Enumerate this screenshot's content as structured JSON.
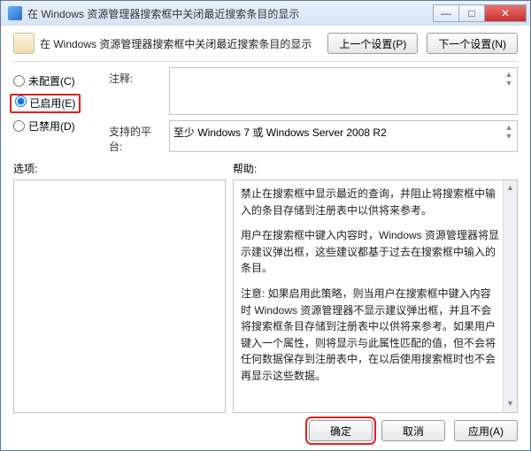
{
  "title": "在 Windows 资源管理器搜索框中关闭最近搜索条目的显示",
  "header_title": "在 Windows 资源管理器搜索框中关闭最近搜索条目的显示",
  "buttons": {
    "prev": "上一个设置(P)",
    "next": "下一个设置(N)",
    "ok": "确定",
    "cancel": "取消",
    "apply": "应用(A)"
  },
  "radios": {
    "not_configured": "未配置(C)",
    "enabled": "已启用(E)",
    "disabled": "已禁用(D)"
  },
  "labels": {
    "comment": "注释:",
    "supported": "支持的平台:",
    "options": "选项:",
    "help": "帮助:"
  },
  "supported_text": "至少 Windows 7 或 Windows Server 2008 R2",
  "help_paragraphs": [
    "禁止在搜索框中显示最近的查询，并阻止将搜索框中输入的条目存储到注册表中以供将来参考。",
    "用户在搜索框中键入内容时，Windows 资源管理器将显示建议弹出框，这些建议都基于过去在搜索框中输入的条目。",
    "注意: 如果启用此策略，则当用户在搜索框中键入内容时 Windows 资源管理器不显示建议弹出框，并且不会将搜索框条目存储到注册表中以供将来参考。如果用户键入一个属性，则将显示与此属性匹配的值，但不会将任何数据保存到注册表中，在以后使用搜索框时也不会再显示这些数据。"
  ]
}
